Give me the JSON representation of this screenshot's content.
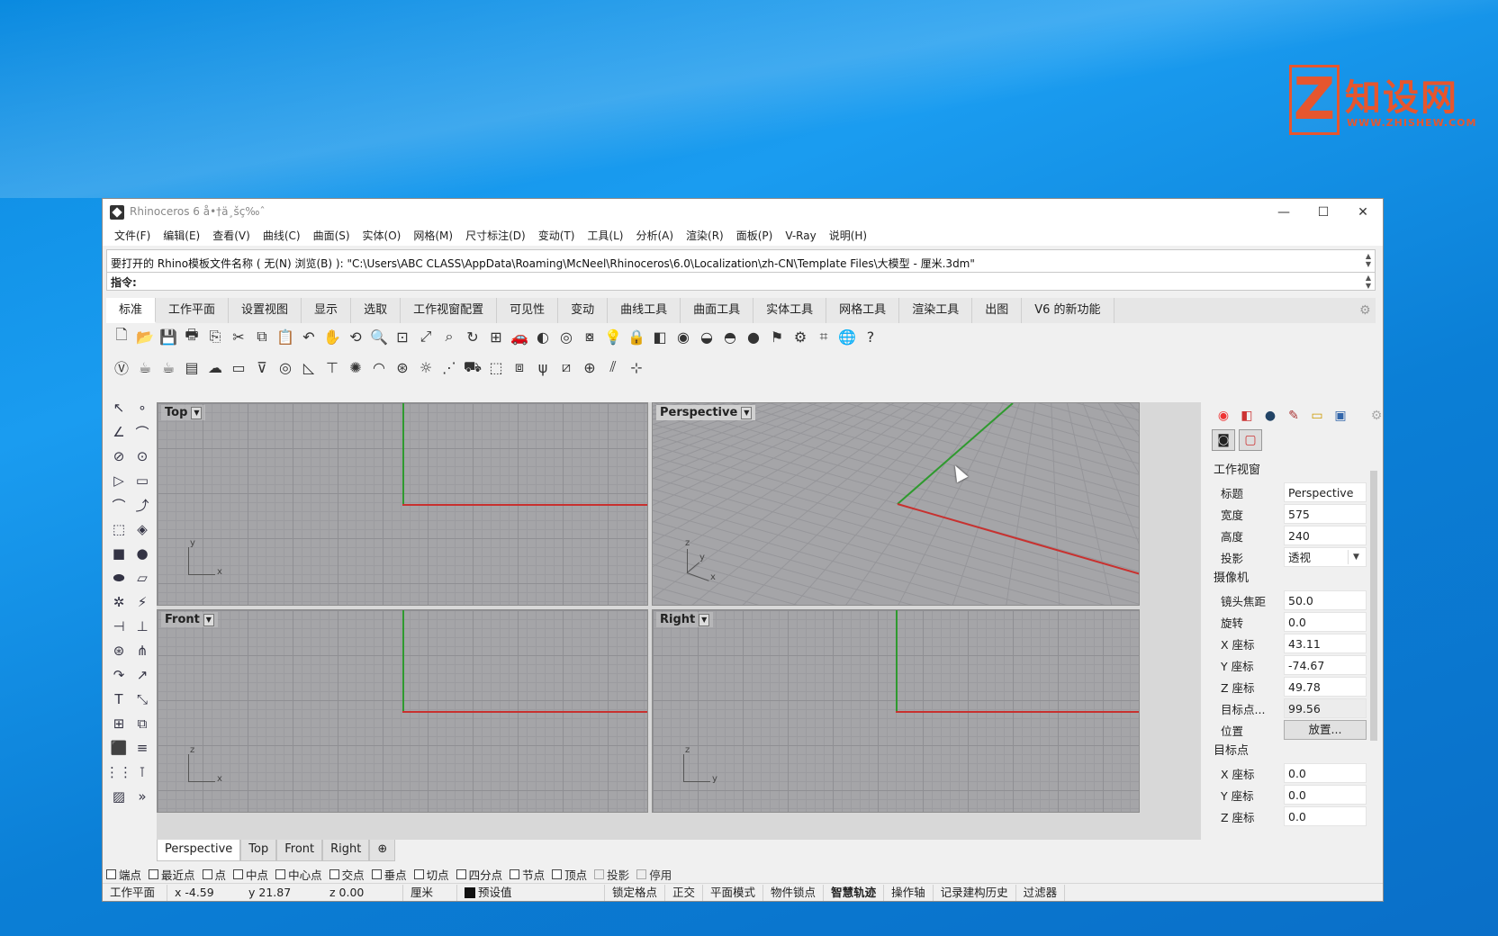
{
  "watermark": {
    "logo_letter": "Z",
    "title": "知设网",
    "subtitle": "WWW.ZHISHEW.COM"
  },
  "window": {
    "title": "Rhinoceros 6 å•†ä¸šç‰ˆ",
    "min": "—",
    "max": "☐",
    "close": "✕"
  },
  "menubar": [
    "文件(F)",
    "编辑(E)",
    "查看(V)",
    "曲线(C)",
    "曲面(S)",
    "实体(O)",
    "网格(M)",
    "尺寸标注(D)",
    "变动(T)",
    "工具(L)",
    "分析(A)",
    "渲染(R)",
    "面板(P)",
    "V-Ray",
    "说明(H)"
  ],
  "command": {
    "history": "要打开的 Rhino模板文件名称 ( 无(N)  浏览(B) ): \"C:\\Users\\ABC CLASS\\AppData\\Roaming\\McNeel\\Rhinoceros\\6.0\\Localization\\zh-CN\\Template Files\\大模型 - 厘米.3dm\"",
    "prompt_label": "指令:",
    "input_value": ""
  },
  "tabs": [
    "标准",
    "工作平面",
    "设置视图",
    "显示",
    "选取",
    "工作视窗配置",
    "可见性",
    "变动",
    "曲线工具",
    "曲面工具",
    "实体工具",
    "网格工具",
    "渲染工具",
    "出图",
    "V6 的新功能"
  ],
  "active_tab": 0,
  "toolbar1": [
    "new-file",
    "open-folder",
    "save",
    "print",
    "import",
    "cut",
    "copy",
    "paste",
    "undo",
    "pan-hand",
    "rotate-view",
    "zoom",
    "zoom-window",
    "zoom-extents",
    "zoom-selected",
    "rotate-view-2",
    "four-viewports",
    "car",
    "shade",
    "circle-target",
    "snapshot",
    "light-bulb",
    "lock",
    "layers",
    "color-wheel",
    "sphere-material",
    "sphere-render",
    "blue-sphere",
    "flag",
    "settings-gears",
    "dimension",
    "green-globe",
    "help"
  ],
  "toolbar2": [
    "vray-logo",
    "teapot",
    "teapot-hand",
    "frame-buffer",
    "cloud",
    "window",
    "light-spot",
    "light-ring",
    "light-angle",
    "light-t",
    "light-burst",
    "light-dome",
    "light-sphere",
    "light-sun",
    "light-lines",
    "render-car",
    "box-proxy",
    "box-export",
    "grass",
    "fur",
    "globe-grid",
    "slashes",
    "crosshair"
  ],
  "viewports": {
    "top": {
      "label": "Top",
      "axis_a": "y",
      "axis_b": "x"
    },
    "perspective": {
      "label": "Perspective",
      "axis_z": "z",
      "axis_a": "y",
      "axis_b": "x"
    },
    "front": {
      "label": "Front",
      "axis_a": "z",
      "axis_b": "x"
    },
    "right": {
      "label": "Right",
      "axis_a": "z",
      "axis_b": "y"
    }
  },
  "viewport_tabs": [
    "Perspective",
    "Top",
    "Front",
    "Right",
    "⊕"
  ],
  "active_viewport_tab": 0,
  "panel": {
    "section_viewport": "工作视窗",
    "title_label": "标题",
    "title_value": "Perspective",
    "width_label": "宽度",
    "width_value": "575",
    "height_label": "高度",
    "height_value": "240",
    "projection_label": "投影",
    "projection_value": "透视",
    "section_camera": "摄像机",
    "focal_label": "镜头焦距",
    "focal_value": "50.0",
    "rotation_label": "旋转",
    "rotation_value": "0.0",
    "cx_label": "X 座标",
    "cx_value": "43.11",
    "cy_label": "Y 座标",
    "cy_value": "-74.67",
    "cz_label": "Z 座标",
    "cz_value": "49.78",
    "target_dist_label": "目标点...",
    "target_dist_value": "99.56",
    "position_label": "位置",
    "position_button": "放置...",
    "section_target": "目标点",
    "tx_label": "X 座标",
    "tx_value": "0.0",
    "ty_label": "Y 座标",
    "ty_value": "0.0",
    "tz_label": "Z 座标",
    "tz_value": "0.0"
  },
  "osnaps": [
    {
      "label": "端点",
      "checked": false
    },
    {
      "label": "最近点",
      "checked": false
    },
    {
      "label": "点",
      "checked": false
    },
    {
      "label": "中点",
      "checked": false
    },
    {
      "label": "中心点",
      "checked": false
    },
    {
      "label": "交点",
      "checked": false
    },
    {
      "label": "垂点",
      "checked": false
    },
    {
      "label": "切点",
      "checked": false
    },
    {
      "label": "四分点",
      "checked": false
    },
    {
      "label": "节点",
      "checked": false
    },
    {
      "label": "顶点",
      "checked": false
    },
    {
      "label": "投影",
      "checked": false,
      "disabled": true
    },
    {
      "label": "停用",
      "checked": false,
      "disabled": true
    }
  ],
  "status": {
    "cplane": "工作平面",
    "x": "x -4.59",
    "y": "y 21.87",
    "z": "z 0.00",
    "units": "厘米",
    "layer": "预设值",
    "grid_snap": "锁定格点",
    "ortho": "正交",
    "planar": "平面模式",
    "osnap": "物件锁点",
    "smarttrack": "智慧轨迹",
    "gumball": "操作轴",
    "history": "记录建构历史",
    "filter": "过滤器"
  },
  "colors": {
    "x_axis": "#c8312f",
    "y_axis": "#2f9a2f",
    "viewport_bg": "#a5a5a8"
  }
}
